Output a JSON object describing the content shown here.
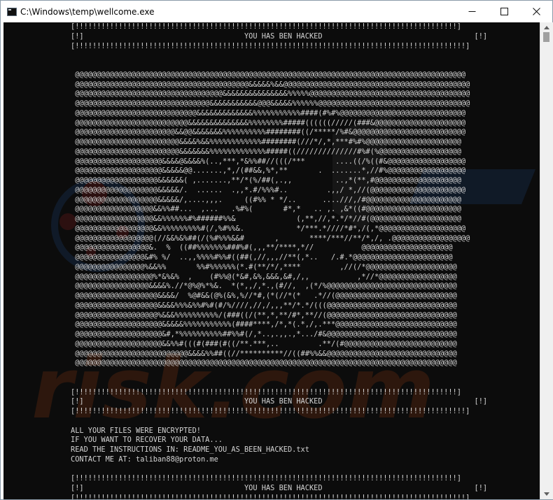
{
  "window": {
    "title": "C:\\Windows\\temp\\wellcome.exe",
    "icon": "console-app-icon",
    "controls": [
      "minimize-icon",
      "maximize-icon",
      "close-icon"
    ]
  },
  "console": {
    "lines": [
      "[!!!!!!!!!!!!!!!!!!!!!!!!!!!!!!!!!!!!!!!!!!!!!!!!!!!!!!!!!!!!!!!!!!!!!!!!!!!!!!!!!!!!!!!!]",
      "[!]                                     YOU HAS BEN HACKED                                   [!]",
      "[!!!!!!!!!!!!!!!!!!!!!!!!!!!!!!!!!!!!!!!!!!!!!!!!!!!!!!!!!!!!!!!!!!!!!!!!!!!!!!!!!!!!!!!!!!]",
      "",
      "",
      " @@@@@@@@@@@@@@@@@@@@@@@@@@@@@@@@@@@@@@@@@@@@@@@@@@@@@@@@@@@@@@@@@@@@@@@@@@@@@@@@@@@@@@@@@@",
      " @@@@@@@@@@@@@@@@@@@@@@@@@@@@@@@@@@@@@@@@&&&&&%&&@@@@@@@@@@@@@@@@@@@@@@@@@@@@@@@@@@@@@@@@@@@",
      " @@@@@@@@@@@@@@@@@@@@@@@@@@@@@@@@@@&&&&&&&&&&&&&&&%%%%%@@@@@@@@@@@@@@@@@@@@@@@@@@@@@@@@@@@@@",
      " @@@@@@@@@@@@@@@@@@@@@@@@@@@@@@@&&&&&&&&&&&@@@&&&&&%%%%%%@@@@@@@@@@@@@@@@@@@@@@@@@@@@@@@@@@@",
      " @@@@@@@@@@@@@@@@@@@@@@@@@@@@&&&&&&&&&&&&&%%%%%%%%%%%####(#%#%@@@@@@@@@@@@@@@@@@@@@@@@@@@@@",
      " @@@@@@@@@@@@@@@@@@@@@@@@@@&&&&&&&&&&&&&&%%%%%%%%#####((((((/////(###&@@@@@@@@@@@@@@@@@@@@@",
      " @@@@@@@@@@@@@@@@@@@@@@@&&@@&&&&&&&%%%%%%%%%%########((/*****/%#&@@@@@@@@@@@@@@@@@@@@@@@@@@",
      " @@@@@@@@@@@@@@@@@@@@@@@@&&&&%&&%%%%%%%%%%%%########(///*/,*,***#%#%@@@@@@@@@@@@@@@@@@@@@@",
      " @@@@@@@@@@@@@@@@@@@@@@@@&&&&&&&%%%%%%%%%%%%%#####((//////////////#%#(%@@@@@@@@@@@@@@@@@@@",
      " @@@@@@@@@@@@@@@@@@@@&&&&@&&&&%(..,***,*&%%##//(((/***       ....((/%((#&@@@@@@@@@@@@@@@@@@",
      " @@@@@@@@@@@@@@@@@@@@&&&&&@@.......,*,/(##&&,%*,**       .  .......*,//#%@@@@@@@@@@@@@@@@@@",
      " @@@@@@@@@@@@@@@@@@@&&&&&&( ,.......,**/*(%/##(,.,,          ..,*(**,#@@@@@@@@@@@@@@@@@@@@",
      " @@@@@@@@@@@@@@@@@@@&&&&&/.  ......  .,,*.#/%%%#..         .,,/ *,//(@@@@@@@@@@@@@@@@@@@@@@",
      " @@@@@@@@@@@@@@@@@@@&&&&&/,....,,,.     ((#%% * */..      ....///,/#@@@@@@@@@@@@@@@@@@@@@@",
      " @@@@@@@@@@@@@@@@@@&&%%##...  ,...   .%#%(       #*,*   .. ,. ,&*((#@@@@@@@@@@@@@@@@@@@@@@",
      " @@@@@@@@@@@@@@@@@@&&%%%%%%#%######%%&              (,**,//,*.*/*//#(@@@@@@@@@@@@@@@@@@@@@",
      " @@@@@@@@@@@@@@@@@@&&%%%%%%%%%#(/,%#%%&.            */***.*////*#*,/(,*@@@@@@@@@@@@@@@@@@@@",
      " @@@@@@@@@@@@@@@@@@(//&&%&%##(/(%#%%%&&#       ,       ****/***//**/*,/, .@@@@@@@@@@@@@@@@@@",
      " @@@@@@@@@@@@@@@@@&.  %  ((##%%%%%%%###%#(,,,**/****,*//           @@@@@@@@@@@@@@@@@@@@@",
      " @@@@@@@@@@@@@@@@&#% %/  ..,,%%%%#%%#((##(,//,,,//**(,*..   /.#.*@@@@@@@@@@@@@@@@@@@@@@@",
      " @@@@@@@@@@@@@@@@%&&%%       %%#%%%%%%(*.#(**/*/,****         ,//(/*@@@@@@@@@@@@@@@@@@@@@",
      " @@@@@@@@@@@@@@@@@@%*&%&%  ,    (#%%@(*&#,&%,&&&,&#,/,,           ,*//*@@@@@@@@@@@@@@@@@@",
      " @@@@@@@@@@@@@@@@@&&&&%.//*@%@%*%&.  *(*,,/,*.,(#//,  ,(*/%@@@@@@@@@@@@@@@@@@@@@@@@@@@@@@",
      " @@@@@@@@@@@@@@@@@@@&&&&/  %@#&&(@%(&%,%//*#,(*(//*(*   .*//(@@@@@@@@@@@@@@@@@@@@@@@@@@@@",
      " @@@@@@@@@@@@@@@@@@@&&&&%%%&%%#%#(#/%////,//,/,,,**/*.*/(((@@@@@@@@@@@@@@@@@@@@@@@@@@@@@@",
      " @@@@@@@@@@@@@@@@@@@%&&&%%%%%%%%%%/(###((/(**,*,**/#*,**//(@@@@@@@@@@@@@@@@@@@@@@@@@@@@@@",
      " @@@@@@@@@@@@@@@@@@@@&&&&&%%%%%%%%%%%(####****,/*,*(.*,/,.***@@@@@@@@@@@@@@@@@@@@@@@@@@@@",
      " @@@@@@@@@@@@@@@@@@@@&#,*%%%%%%%%%%##%%#(/,*..,.,,.,*.../#&@@@@@@@@@@@@@@@@@@@@@@@@@@@@@@",
      " @@@@@@@@@@@@@@@@@@@@&&%%#(((#(###(#((/**.***,..         .**/(#@@@@@@@@@@@@@@@@@@@@@@@@@@",
      " @@@@@@@@@@@@@@@@@@@@@@@@@@&&&&%%##((//**********//((##%%&&@@@@@@@@@@@@@@@@@@@@@@@@@@@@@@",
      " @@@@@@@@@@@@@@@@@@@@@@@@@@@@@@@@@@@@@@@@@@@@@@@@@@@@@@@@@@@@@@@@@@@@@@@@@@@@@@@@@@@@@@@@",
      "",
      "",
      "[!!!!!!!!!!!!!!!!!!!!!!!!!!!!!!!!!!!!!!!!!!!!!!!!!!!!!!!!!!!!!!!!!!!!!!!!!!!!!!!!!!!!!!!!]",
      "[!]                                     YOU HAS BEN HACKED                                   [!]",
      "[!!!!!!!!!!!!!!!!!!!!!!!!!!!!!!!!!!!!!!!!!!!!!!!!!!!!!!!!!!!!!!!!!!!!!!!!!!!!!!!!!!!!!!!!!!]",
      "",
      "ALL YOUR FILES WERE ENCRYPTED!",
      "IF YOU WANT TO RECOVER YOUR DATA...",
      "READ THE INSTRUCTIONS IN: README_YOU_AS_BEEN_HACKED.txt",
      "CONTACT ME AT: taliban88@proton.me",
      "",
      "[!!!!!!!!!!!!!!!!!!!!!!!!!!!!!!!!!!!!!!!!!!!!!!!!!!!!!!!!!!!!!!!!!!!!!!!!!!!!!!!!!!!!!!!!]",
      "[!]                                     YOU HAS BEN HACKED                                   [!]",
      "[!!!!!!!!!!!!!!!!!!!!!!!!!!!!!!!!!!!!!!!!!!!!!!!!!!!!!!!!!!!!!!!!!!!!!!!!!!!!!!!!!!!!!!!!!!]"
    ]
  },
  "watermark": {
    "text": "risk.com",
    "color": "#6a2e10"
  },
  "colors": {
    "console_bg": "#0c0c0c",
    "console_fg": "#d4d4d4",
    "titlebar_bg": "#ffffff"
  }
}
